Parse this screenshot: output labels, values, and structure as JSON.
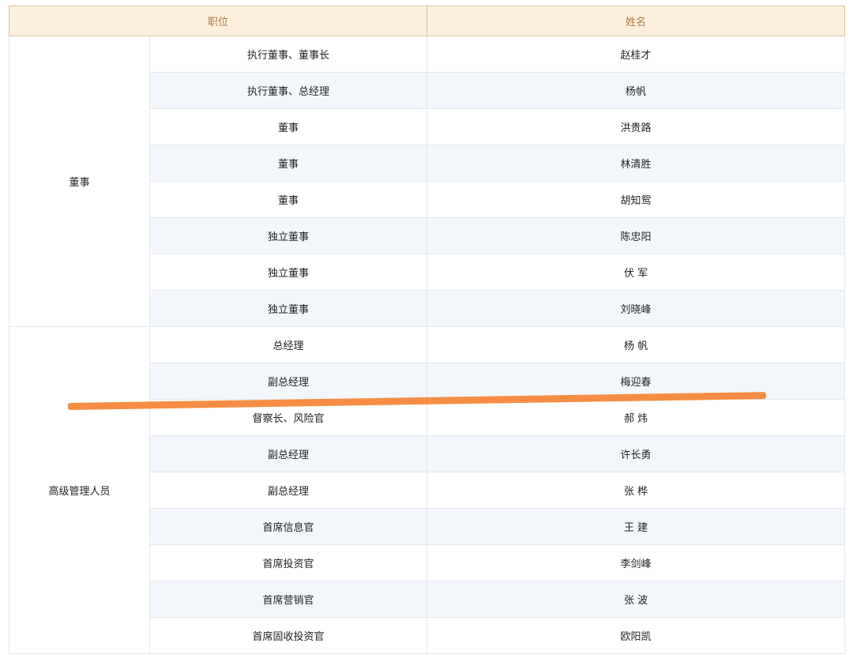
{
  "headers": {
    "position": "职位",
    "name": "姓名"
  },
  "groups": [
    {
      "label": "董事",
      "rows": [
        {
          "position": "执行董事、董事长",
          "name": "赵桂才"
        },
        {
          "position": "执行董事、总经理",
          "name": "杨帆"
        },
        {
          "position": "董事",
          "name": "洪贵路"
        },
        {
          "position": "董事",
          "name": "林清胜"
        },
        {
          "position": "董事",
          "name": "胡知鸳"
        },
        {
          "position": "独立董事",
          "name": "陈忠阳"
        },
        {
          "position": "独立董事",
          "name": "伏 军"
        },
        {
          "position": "独立董事",
          "name": "刘晓峰"
        }
      ]
    },
    {
      "label": "高级管理人员",
      "rows": [
        {
          "position": "总经理",
          "name": "杨 帆"
        },
        {
          "position": "副总经理",
          "name": "梅迎春"
        },
        {
          "position": "督察长、风险官",
          "name": "郝 炜"
        },
        {
          "position": "副总经理",
          "name": "许长勇"
        },
        {
          "position": "副总经理",
          "name": "张 桦"
        },
        {
          "position": "首席信息官",
          "name": "王 建"
        },
        {
          "position": "首席投资官",
          "name": "李剑峰"
        },
        {
          "position": "首席营销官",
          "name": "张 波"
        },
        {
          "position": "首席固收投资官",
          "name": "欧阳凯"
        }
      ]
    }
  ],
  "colors": {
    "header_bg": "#fcf0dc",
    "header_text": "#a77a3f",
    "row_alt_bg": "#f3f7fc",
    "strike_mark": "#f4883a"
  }
}
